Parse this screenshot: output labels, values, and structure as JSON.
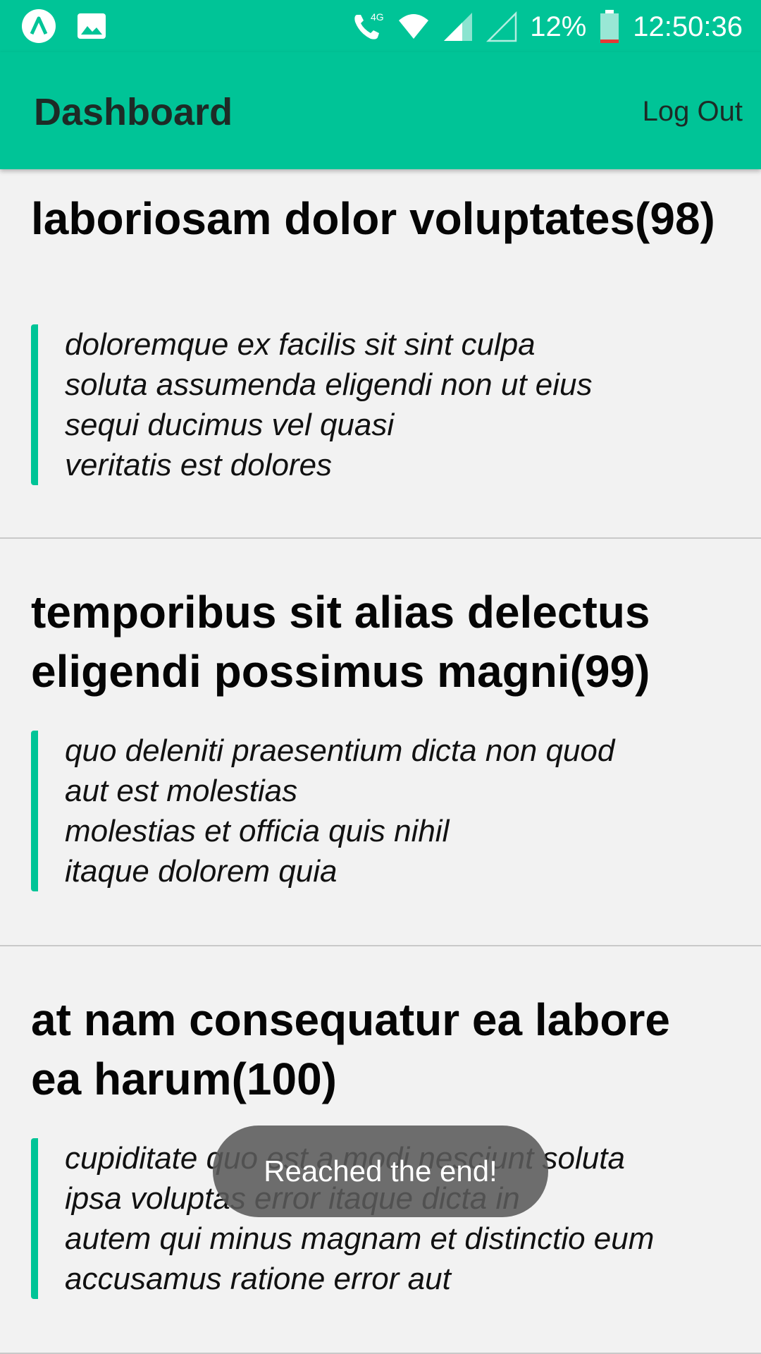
{
  "status_bar": {
    "network_label": "4G",
    "battery": "12%",
    "time": "12:50:36",
    "icons": [
      "app-a-icon",
      "image-icon",
      "volte-call-icon",
      "wifi-icon",
      "signal-icon",
      "signal-empty-icon",
      "battery-icon"
    ]
  },
  "appbar": {
    "title": "Dashboard",
    "logout_label": "Log Out"
  },
  "posts": [
    {
      "title": "laboriosam dolor voluptates(98)",
      "body_lines": [
        "doloremque ex facilis sit sint culpa",
        "soluta assumenda eligendi non ut eius",
        "sequi ducimus vel quasi",
        "veritatis est dolores"
      ]
    },
    {
      "title": "temporibus sit alias delectus eligendi possimus magni(99)",
      "body_lines": [
        "quo deleniti praesentium dicta non quod",
        "aut est molestias",
        "molestias et officia quis nihil",
        "itaque dolorem quia"
      ]
    },
    {
      "title": "at nam consequatur ea labore ea harum(100)",
      "body_lines": [
        "cupiditate quo est a modi nesciunt soluta",
        "ipsa voluptas error itaque dicta in",
        "autem qui minus magnam et distinctio eum",
        "accusamus ratione error aut"
      ]
    }
  ],
  "toast": {
    "text": "Reached the end!"
  },
  "colors": {
    "accent": "#00c497",
    "background": "#f2f2f2",
    "divider": "#c9c9c9",
    "toast_bg": "#5a5a5a"
  }
}
